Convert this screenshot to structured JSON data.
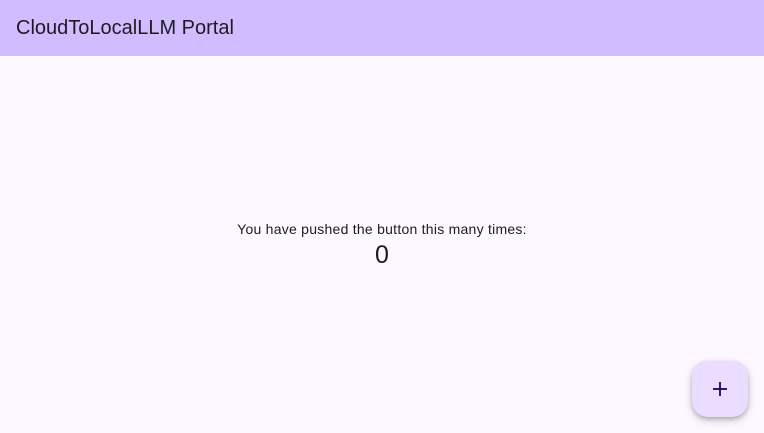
{
  "app_bar": {
    "title": "CloudToLocalLLM Portal"
  },
  "main": {
    "message": "You have pushed the button this many times:",
    "counter_value": "0"
  },
  "fab": {
    "icon": "plus-icon"
  },
  "colors": {
    "app_bar_background": "#d0bcff",
    "page_background": "#fdf7ff",
    "fab_background": "#eaddff",
    "text": "#1d1b20"
  }
}
